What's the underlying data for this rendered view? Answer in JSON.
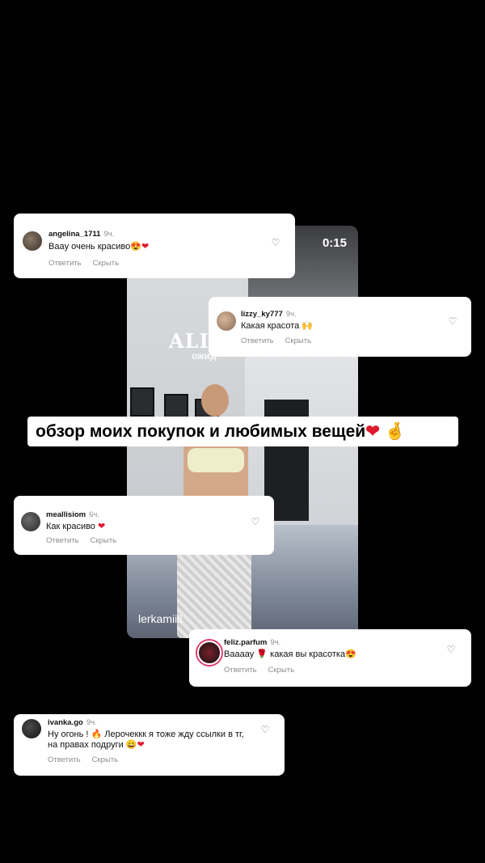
{
  "video": {
    "time": "0:15",
    "brand": "ALI",
    "brand_sub": "ожид",
    "username": "lerkamiill"
  },
  "caption": {
    "text": "обзор моих покупок и любимых вещей",
    "emoji_heart": "❤",
    "emoji_hand": "🤞"
  },
  "comments": [
    {
      "user": "angelina_1711",
      "time": "9ч.",
      "text": "Вааy очень красиво",
      "emoji": "😍❤",
      "reply": "Ответить",
      "hide": "Скрыть"
    },
    {
      "user": "lizzy_ky777",
      "time": "9ч.",
      "text": "Какая красота",
      "emoji": "🙌",
      "reply": "Ответить",
      "hide": "Скрыть"
    },
    {
      "user": "meallisiom",
      "time": "6ч.",
      "text": "Как красиво",
      "emoji": "❤",
      "reply": "Ответить",
      "hide": "Скрыть"
    },
    {
      "user": "feliz.parfum",
      "time": "9ч.",
      "text": "Вааааy",
      "emoji": "🌹",
      "text2": "какая вы красотка",
      "emoji2": "😍",
      "reply": "Ответить",
      "hide": "Скрыть"
    },
    {
      "user": "ivanka.go",
      "time": "9ч.",
      "text": "Ну огонь !",
      "emoji": "🔥",
      "text2": "Лерочеккк я тоже жду ссылки в тг, на правах подруги",
      "emoji2": "😄❤",
      "reply": "Ответить",
      "hide": "Скрыть"
    }
  ],
  "icons": {
    "like": "heart-outline-icon"
  }
}
